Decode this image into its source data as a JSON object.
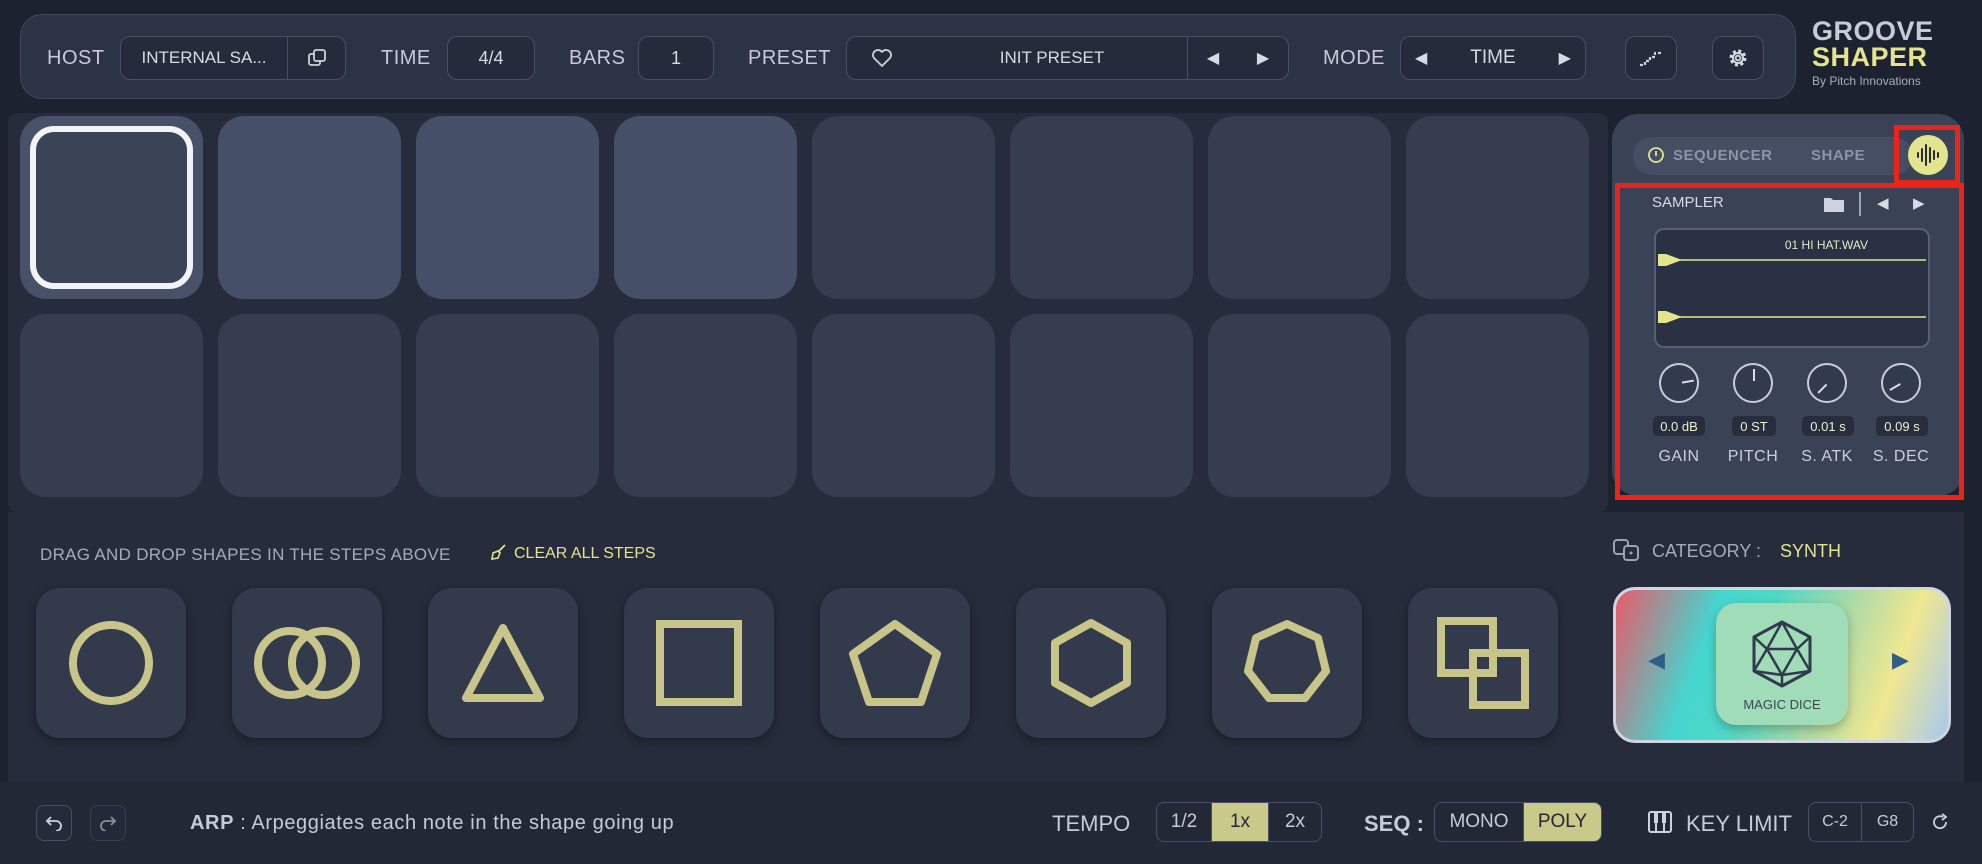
{
  "brand": {
    "line1": "GROOVE",
    "line2": "SHAPER",
    "byline": "By Pitch Innovations"
  },
  "topbar": {
    "host_label": "HOST",
    "host_value": "INTERNAL SA...",
    "time_label": "TIME",
    "time_value": "4/4",
    "bars_label": "BARS",
    "bars_value": "1",
    "preset_label": "PRESET",
    "preset_value": "INIT PRESET",
    "mode_label": "MODE",
    "mode_value": "TIME"
  },
  "side": {
    "tab_sequencer": "SEQUENCER",
    "tab_shape": "SHAPE",
    "sampler_label": "SAMPLER",
    "sample_name": "01 HI HAT.WAV",
    "knobs": [
      {
        "label": "GAIN",
        "value": "0.0 dB"
      },
      {
        "label": "PITCH",
        "value": "0 ST"
      },
      {
        "label": "S. ATK",
        "value": "0.01 s"
      },
      {
        "label": "S. DEC",
        "value": "0.09 s"
      }
    ]
  },
  "shapes_bar": {
    "instruction": "DRAG AND DROP SHAPES IN THE STEPS ABOVE",
    "clear": "CLEAR ALL STEPS",
    "category_label": "CATEGORY :",
    "category_value": "SYNTH",
    "magic_dice": "MAGIC DICE",
    "shapes": [
      "circle-shape",
      "double-circle-shape",
      "triangle-shape",
      "square-shape",
      "pentagon-shape",
      "hexagon-shape",
      "heptagon-shape",
      "overlapping-squares-shape"
    ]
  },
  "footer": {
    "arp_label": "ARP",
    "arp_desc": " : Arpeggiates each note in the shape going up",
    "tempo_label": "TEMPO",
    "tempo_options": [
      "1/2",
      "1x",
      "2x"
    ],
    "tempo_selected": "1x",
    "seq_label": "SEQ :",
    "seq_options": [
      "MONO",
      "POLY"
    ],
    "seq_selected": "POLY",
    "key_limit_label": "KEY LIMIT",
    "key_low": "C-2",
    "key_high": "G8"
  },
  "colors": {
    "accent": "#dfe08e",
    "highlight_red": "#e8241b",
    "bg": "#262c3b"
  }
}
